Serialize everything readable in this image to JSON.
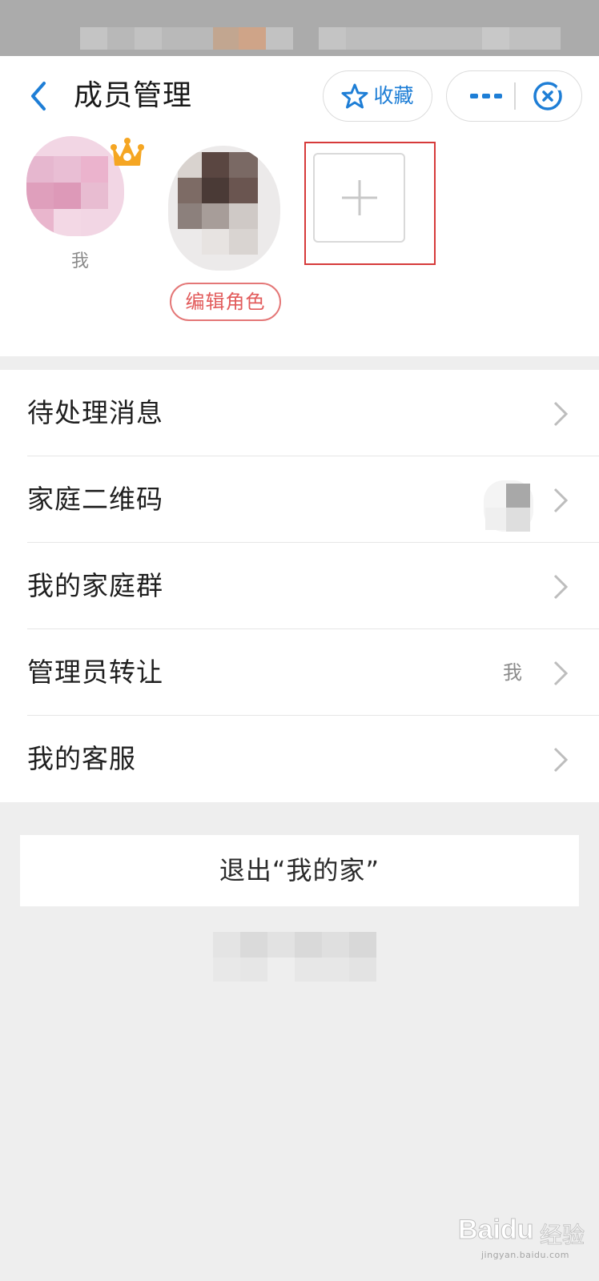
{
  "header": {
    "title": "成员管理",
    "favorite_label": "收藏",
    "more_icon": "more-dots-icon",
    "close_icon": "close-mini-program-icon",
    "back_icon": "back-arrow-icon"
  },
  "members": [
    {
      "name": "我",
      "is_admin": true,
      "crown_icon": "crown-icon"
    },
    {
      "name": "",
      "action_label": "编辑角色"
    }
  ],
  "add_member_icon": "plus-icon",
  "menu": [
    {
      "label": "待处理消息",
      "value": ""
    },
    {
      "label": "家庭二维码",
      "value": ""
    },
    {
      "label": "我的家庭群",
      "value": ""
    },
    {
      "label": "管理员转让",
      "value": "我"
    },
    {
      "label": "我的客服",
      "value": ""
    }
  ],
  "exit_label": "退出“我的家”",
  "watermark": {
    "brand": "Baidu",
    "name": "经验",
    "url": "jingyan.baidu.com"
  },
  "colors": {
    "accent_blue": "#1e7ed6",
    "edit_role_red": "#e25b5b",
    "highlight_frame": "#d63a3a",
    "crown_orange": "#f5a623"
  }
}
